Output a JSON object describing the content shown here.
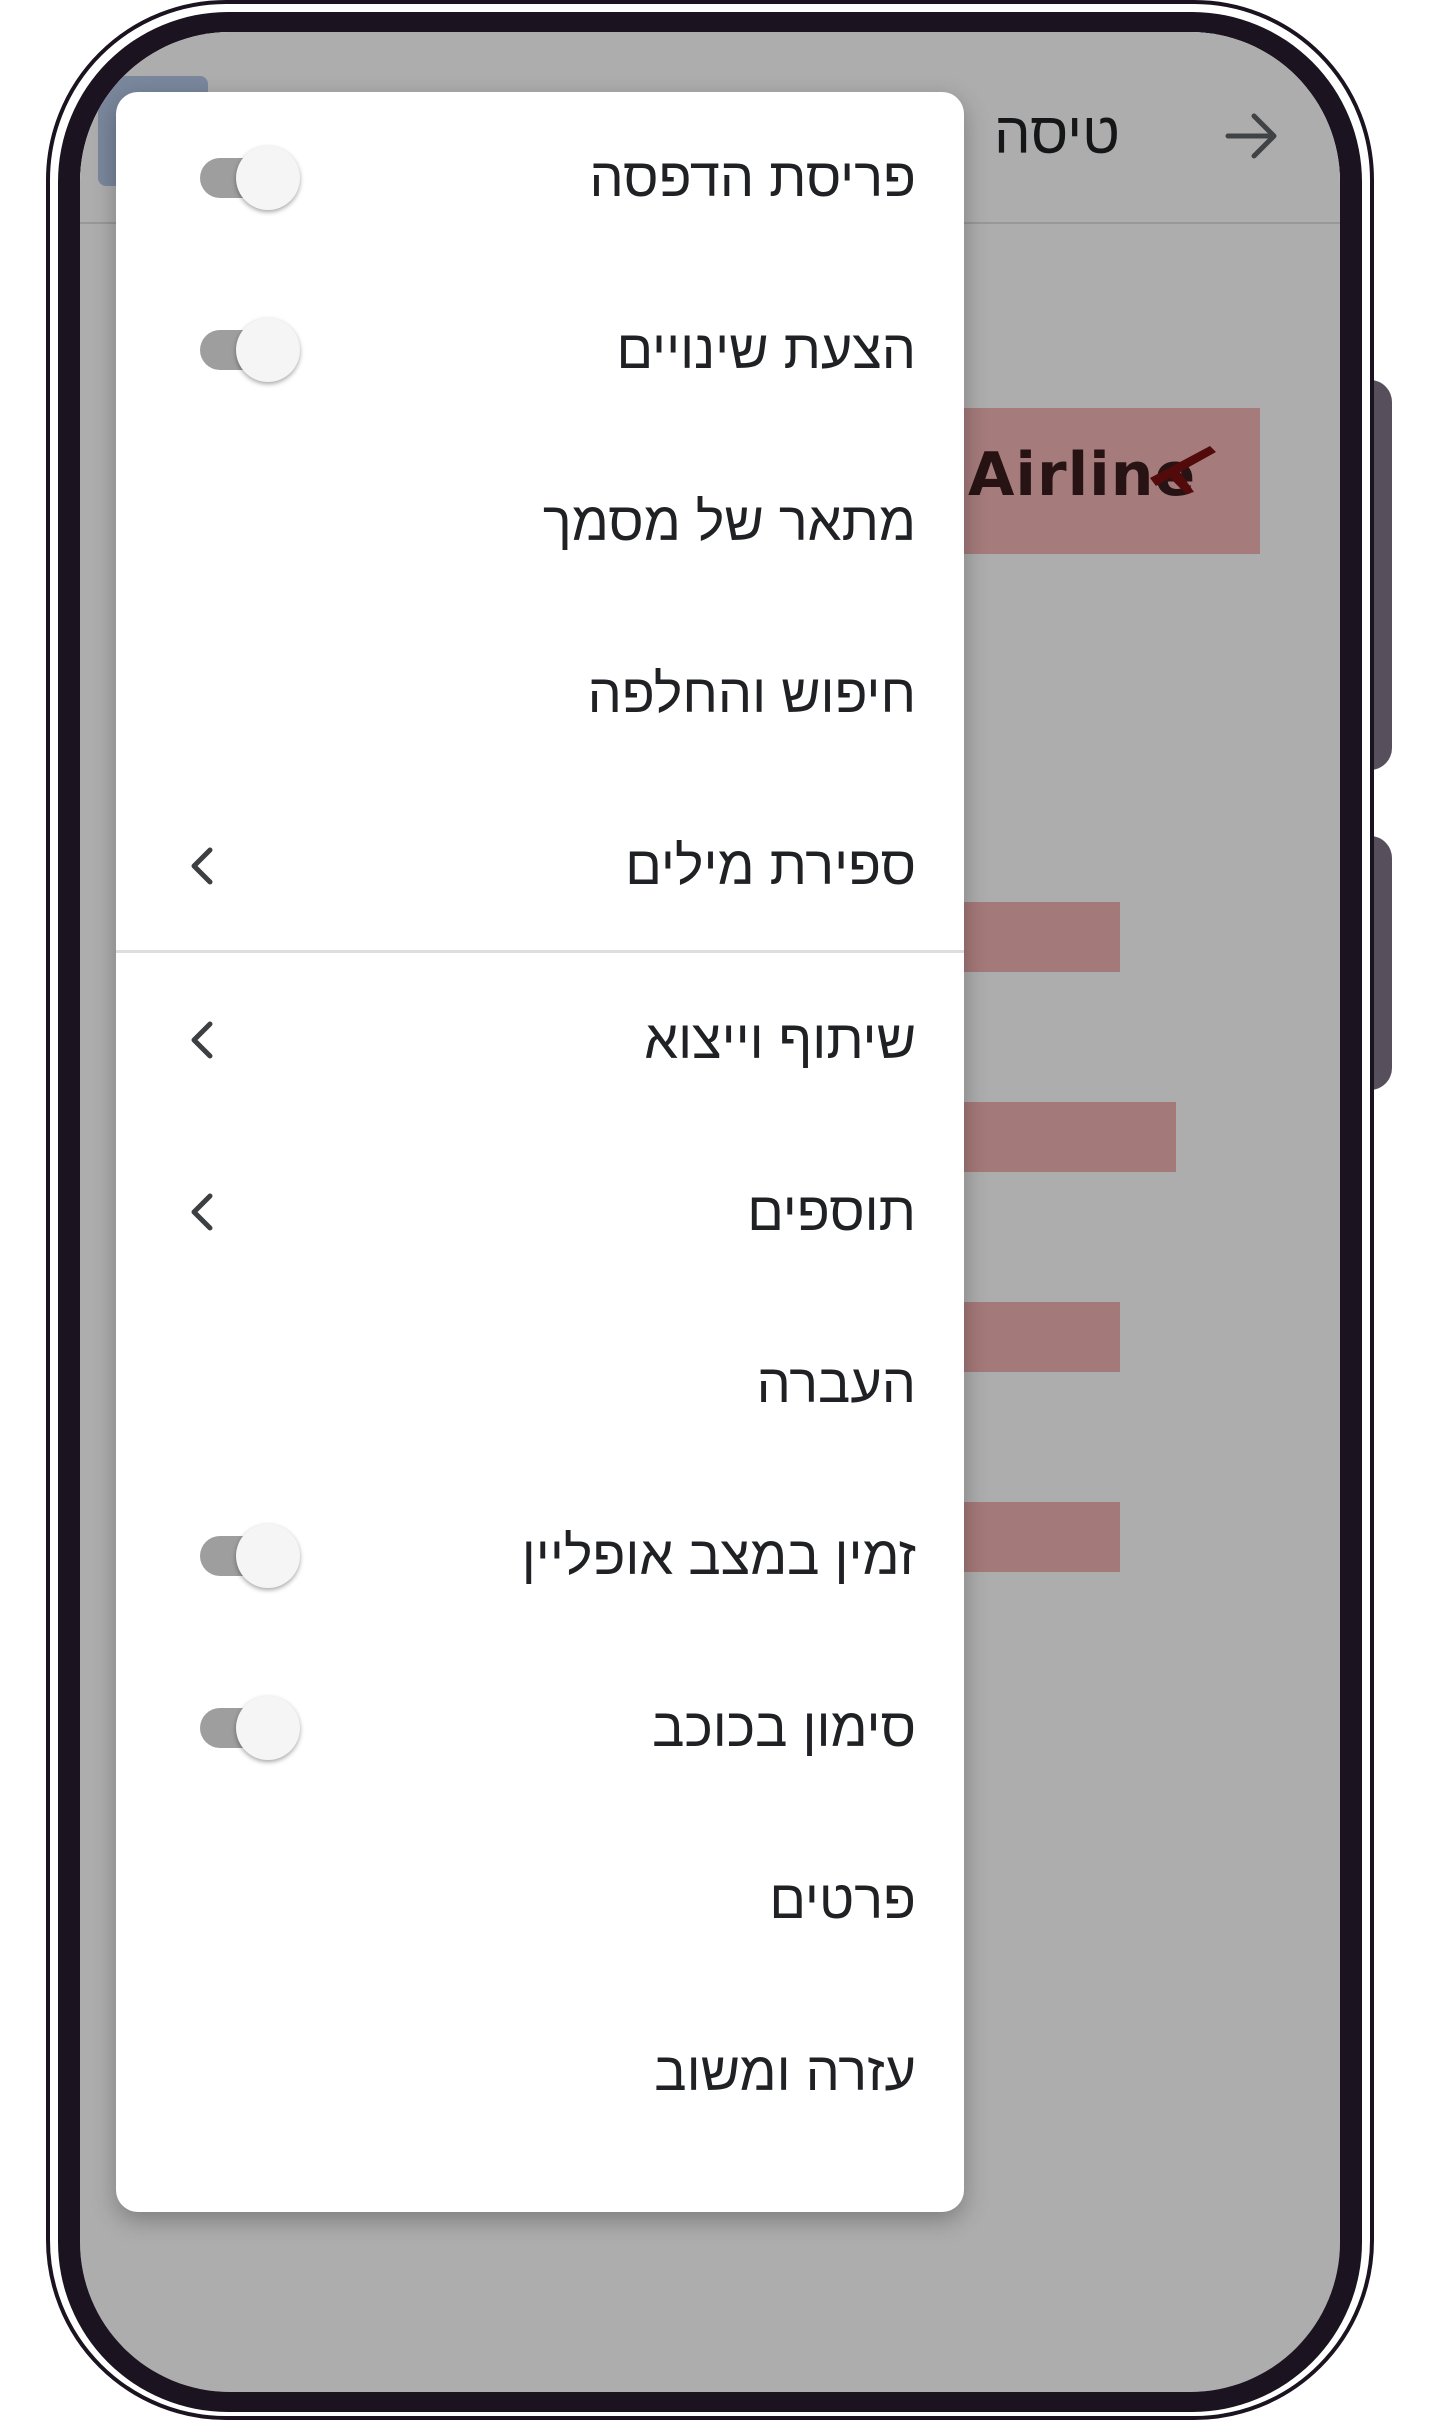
{
  "app": {
    "title": "טיסה",
    "logo_text": "Airline",
    "logo_color": "#f3b6b6",
    "back_icon": "arrow-right-icon"
  },
  "menu": {
    "items": [
      {
        "label": "פריסת הדפסה",
        "control": "toggle",
        "state": "off"
      },
      {
        "label": "הצעת שינויים",
        "control": "toggle",
        "state": "off"
      },
      {
        "label": "מתאר של מסמך",
        "control": "none"
      },
      {
        "label": "חיפוש והחלפה",
        "control": "none"
      },
      {
        "label": "ספירת מילים",
        "control": "chevron",
        "icon": "chevron-left-icon"
      },
      {
        "label": "שיתוף וייצוא",
        "control": "chevron",
        "icon": "chevron-left-icon"
      },
      {
        "label": "תוספים",
        "control": "chevron",
        "icon": "chevron-left-icon"
      },
      {
        "label": "העברה",
        "control": "none"
      },
      {
        "label": "זמין במצב אופליין",
        "control": "toggle",
        "state": "off"
      },
      {
        "label": "סימון בכוכב",
        "control": "toggle",
        "state": "off"
      },
      {
        "label": "פרטים",
        "control": "none"
      },
      {
        "label": "עזרה ומשוב",
        "control": "none"
      }
    ]
  }
}
